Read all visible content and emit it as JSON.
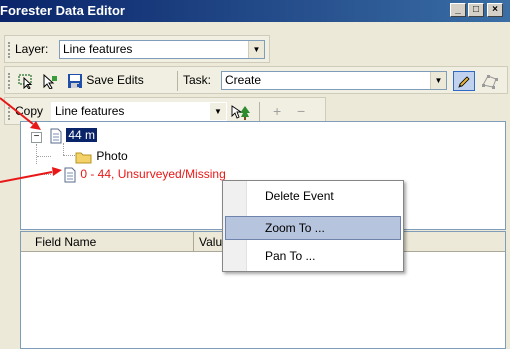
{
  "window": {
    "title": "Forester Data Editor",
    "controls": [
      "_",
      "□",
      "×"
    ]
  },
  "layer_bar": {
    "label": "Layer:",
    "value": "Line features"
  },
  "edit_bar": {
    "save_label": "Save Edits",
    "task_label": "Task:",
    "task_value": "Create"
  },
  "copy_bar": {
    "label": "Copy",
    "value": "Line features",
    "plus": "+",
    "minus": "−"
  },
  "tree": {
    "root_label": "44 m",
    "child_folder": "Photo",
    "child_event": "0 - 44, Unsurveyed/Missing"
  },
  "grid": {
    "columns": [
      "Field Name",
      "Value"
    ]
  },
  "context_menu": {
    "items": [
      "Delete Event",
      "Zoom To ...",
      "Pan To ..."
    ],
    "highlighted": "Zoom To ..."
  },
  "colors": {
    "accent": "#0a246a",
    "event_text": "#e81818",
    "annotation_arrow": "#e81818",
    "menu_highlight": "#b6c4dd"
  }
}
